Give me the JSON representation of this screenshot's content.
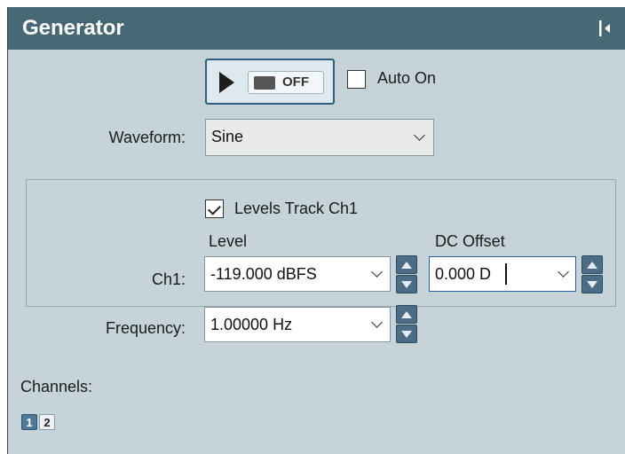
{
  "panel": {
    "title": "Generator",
    "pin_icon": "pin-dock-icon"
  },
  "generator_button": {
    "state_label": "OFF",
    "play_icon": "play-icon"
  },
  "auto_on": {
    "label": "Auto On",
    "checked": false
  },
  "waveform": {
    "label": "Waveform:",
    "value": "Sine"
  },
  "levels_track": {
    "label": "Levels Track Ch1",
    "checked": true
  },
  "columns": {
    "level_header": "Level",
    "dc_offset_header": "DC Offset"
  },
  "ch1": {
    "label": "Ch1:",
    "level_value": "-119.000 dBFS",
    "dc_offset_value": "0.000 D"
  },
  "frequency": {
    "label": "Frequency:",
    "value": "1.00000 Hz"
  },
  "channels": {
    "label": "Channels:",
    "buttons": [
      {
        "label": "1",
        "active": true
      },
      {
        "label": "2",
        "active": false
      }
    ]
  },
  "colors": {
    "title_bar": "#476875",
    "panel_bg": "#c6d3d8",
    "accent": "#4b6d86"
  }
}
